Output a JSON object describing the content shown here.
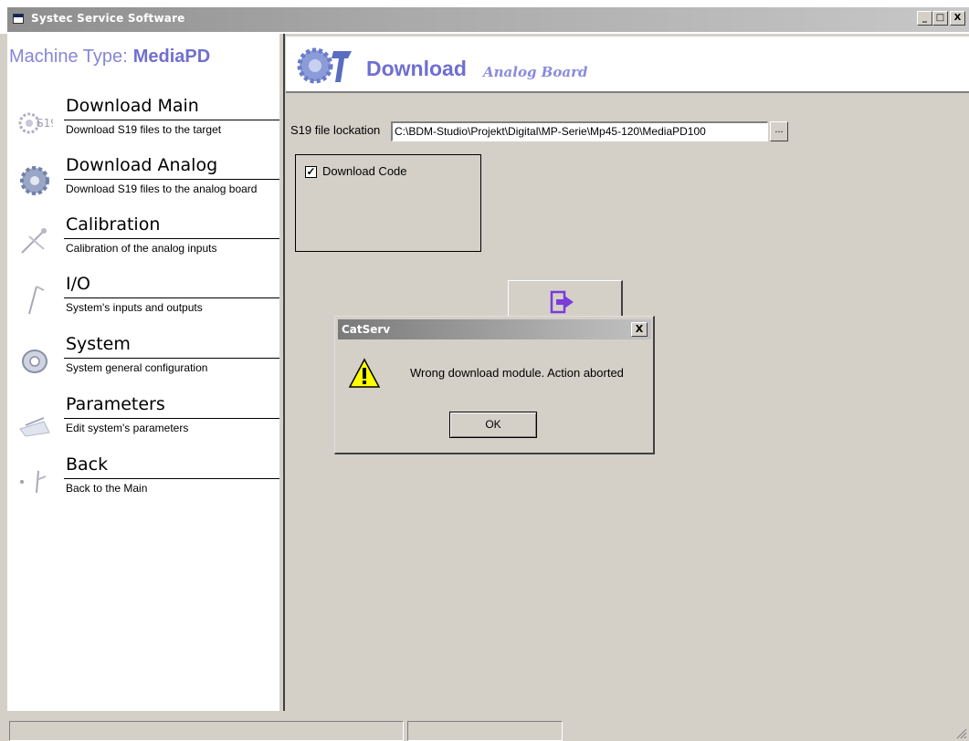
{
  "window": {
    "title": "Systec Service Software",
    "minimize": "_",
    "maximize": "□",
    "close": "X"
  },
  "sidebar": {
    "machine_type_label": "Machine Type:",
    "machine_type_value": "MediaPD",
    "items": [
      {
        "title": "Download Main",
        "desc": "Download S19 files to the target",
        "icon": "gears-download-icon"
      },
      {
        "title": "Download Analog",
        "desc": "Download S19 files to the analog board",
        "icon": "gear-icon"
      },
      {
        "title": "Calibration",
        "desc": "Calibration of the analog inputs",
        "icon": "calibration-icon"
      },
      {
        "title": "I/O",
        "desc": "System's inputs and outputs",
        "icon": "io-icon"
      },
      {
        "title": "System",
        "desc": "System general configuration",
        "icon": "system-disc-icon"
      },
      {
        "title": "Parameters",
        "desc": "Edit system's parameters",
        "icon": "parameters-icon"
      },
      {
        "title": "Back",
        "desc": "Back to the Main",
        "icon": "back-icon"
      }
    ]
  },
  "main": {
    "header_title": "Download",
    "header_subtitle": "Analog Board",
    "s19_label": "S19 file lockation",
    "s19_value": "C:\\BDM-Studio\\Projekt\\Digital\\MP-Serie\\Mp45-120\\MediaPD100",
    "browse_label": "...",
    "download_code_label": "Download Code",
    "download_code_checked": true,
    "action_icon": "download-arrow-icon"
  },
  "dialog": {
    "title": "CatServ",
    "message": "Wrong download module. Action aborted",
    "ok_label": "OK",
    "close_label": "X",
    "icon": "warning-icon"
  },
  "statusbar": {
    "pane1": "",
    "pane2": ""
  },
  "colors": {
    "accent": "#6f6fd0",
    "title_gradient_start": "#8e8e8e",
    "dialog_bg": "#d4d0c8"
  }
}
